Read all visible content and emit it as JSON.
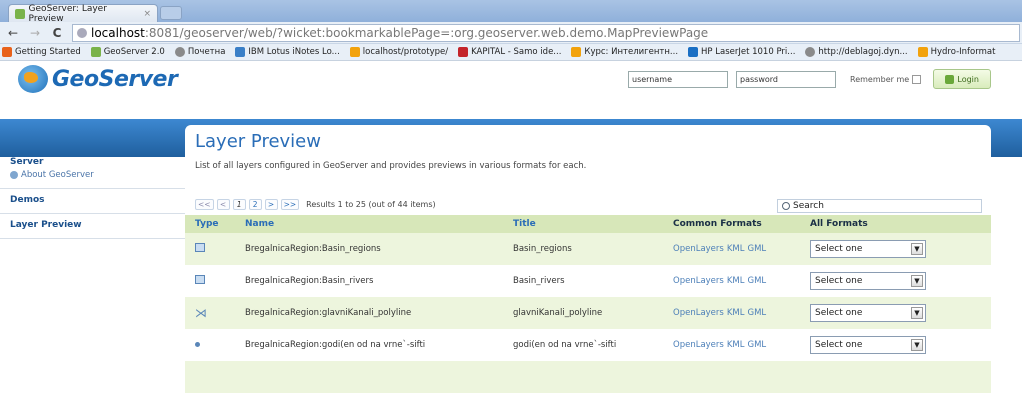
{
  "browser": {
    "tab_title": "GeoServer: Layer Preview",
    "tab_close": "×",
    "url_host": "localhost",
    "url_rest": ":8081/geoserver/web/?wicket:bookmarkablePage=:org.geoserver.web.demo.MapPreviewPage",
    "back": "←",
    "forward": "→",
    "reload": "C",
    "bookmarks": [
      {
        "label": "Getting Started",
        "color": "#e8621b"
      },
      {
        "label": "GeoServer 2.0",
        "color": "#7ab34a"
      },
      {
        "label": "Почетна",
        "color": "#8a8a8a"
      },
      {
        "label": "IBM Lotus iNotes Lo...",
        "color": "#3a7fc7"
      },
      {
        "label": "localhost/prototype/",
        "color": "#f2a20c"
      },
      {
        "label": "KAPITAL - Samo ide...",
        "color": "#c4242a"
      },
      {
        "label": "Курс: Интелигентн...",
        "color": "#f2a20c"
      },
      {
        "label": "HP LaserJet 1010 Pri...",
        "color": "#1a6fc4"
      },
      {
        "label": "http://deblagoj.dyn...",
        "color": "#8a8a8a"
      },
      {
        "label": "Hydro-Informat",
        "color": "#f2a20c"
      }
    ]
  },
  "header": {
    "logo_text": "GeoServer",
    "username_placeholder": "username",
    "password_placeholder": "password",
    "remember_label": "Remember me",
    "login_label": "Login"
  },
  "sidebar": {
    "server": "Server",
    "about": "About GeoServer",
    "demos": "Demos",
    "layer_preview": "Layer Preview"
  },
  "main": {
    "title": "Layer Preview",
    "description": "List of all layers configured in GeoServer and provides previews in various formats for each.",
    "pager": {
      "first": "<<",
      "prev": "<",
      "page1": "1",
      "page2": "2",
      "next": ">",
      "last": ">>",
      "results": "Results 1 to 25 (out of 44 items)"
    },
    "search_label": "Search",
    "columns": {
      "type": "Type",
      "name": "Name",
      "title": "Title",
      "common": "Common Formats",
      "all": "All Formats"
    },
    "rows": [
      {
        "type": "polygon",
        "name": "BregalnicaRegion:Basin_regions",
        "title": "Basin_regions",
        "fmt1": "OpenLayers",
        "fmt2": "KML",
        "fmt3": "GML",
        "select": "Select one"
      },
      {
        "type": "polygon",
        "name": "BregalnicaRegion:Basin_rivers",
        "title": "Basin_rivers",
        "fmt1": "OpenLayers",
        "fmt2": "KML",
        "fmt3": "GML",
        "select": "Select one"
      },
      {
        "type": "line",
        "name": "BregalnicaRegion:glavniKanali_polyline",
        "title": "glavniKanali_polyline",
        "fmt1": "OpenLayers",
        "fmt2": "KML",
        "fmt3": "GML",
        "select": "Select one"
      },
      {
        "type": "point",
        "name": "BregalnicaRegion:godi(en od na vrne`-sifti",
        "title": "godi(en od na vrne`-sifti",
        "fmt1": "OpenLayers",
        "fmt2": "KML",
        "fmt3": "GML",
        "select": "Select one"
      }
    ]
  }
}
